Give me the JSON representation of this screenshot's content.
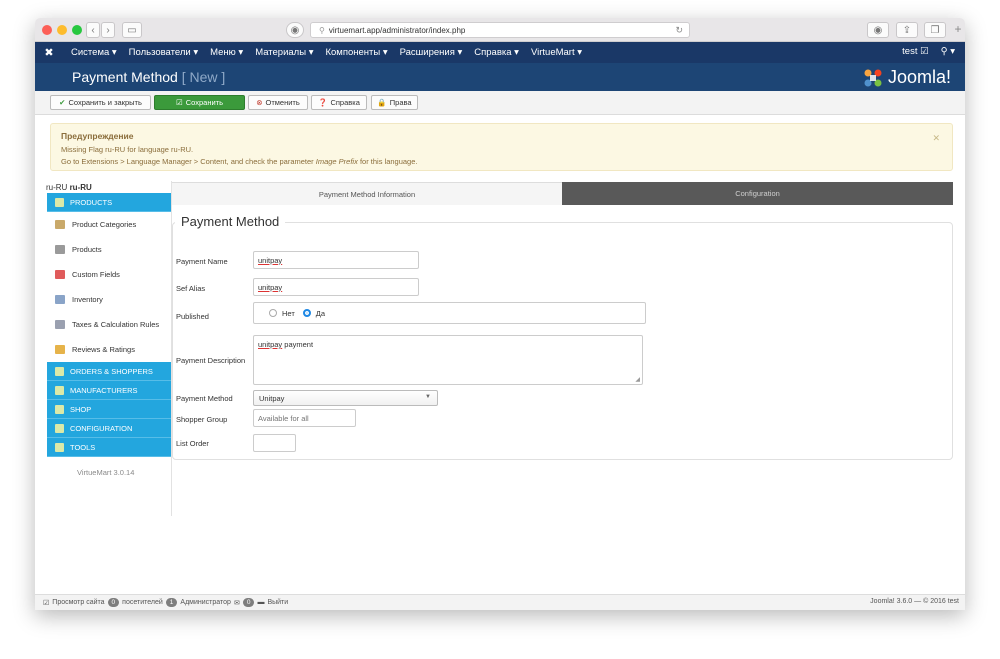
{
  "browser": {
    "url": "virtuemart.app/administrator/index.php"
  },
  "adminbar": {
    "menu": [
      "Система ▾",
      "Пользователи ▾",
      "Меню ▾",
      "Материалы ▾",
      "Компоненты ▾",
      "Расширения ▾",
      "Справка ▾",
      "VirtueMart ▾"
    ],
    "user": "test ☑",
    "user_menu": "⚲ ▾"
  },
  "header": {
    "title": "Payment Method",
    "subtitle": "[ New ]",
    "brand": "Joomla!"
  },
  "toolbar": {
    "save_close": "Сохранить и закрыть",
    "save": "Сохранить",
    "cancel": "Отменить",
    "help": "Справка",
    "rights": "Права"
  },
  "warning": {
    "title": "Предупреждение",
    "line1": "Missing Flag ru-RU for language ru-RU.",
    "line2_prefix": "Go to Extensions > Language Manager > Content, and check the parameter ",
    "line2_em": "Image Prefix",
    "line2_suffix": " for this language."
  },
  "lang": {
    "prefix": "ru-RU ",
    "bold": "ru-RU"
  },
  "sidebar": {
    "products_header": "PRODUCTS",
    "items": [
      {
        "label": "Product Categories",
        "icon_color": "#c9a96a"
      },
      {
        "label": "Products",
        "icon_color": "#9a9a9a"
      },
      {
        "label": "Custom Fields",
        "icon_color": "#e05b5b"
      },
      {
        "label": "Inventory",
        "icon_color": "#8aa4c8"
      },
      {
        "label": "Taxes & Calculation Rules",
        "icon_color": "#9aa0b0"
      },
      {
        "label": "Reviews & Ratings",
        "icon_color": "#e6b34a"
      }
    ],
    "categories": [
      "ORDERS & SHOPPERS",
      "MANUFACTURERS",
      "SHOP",
      "CONFIGURATION",
      "TOOLS"
    ],
    "version": "VirtueMart 3.0.14"
  },
  "tabs": {
    "info": "Payment Method Information",
    "config": "Configuration"
  },
  "form": {
    "legend": "Payment Method",
    "name_label": "Payment Name",
    "name_value": "unitpay",
    "alias_label": "Sef Alias",
    "alias_value": "unitpay",
    "published_label": "Published",
    "published_no": "Нет",
    "published_yes": "Да",
    "description_label": "Payment Description",
    "description_word": "unitpay",
    "description_rest": " payment",
    "method_label": "Payment Method",
    "method_value": "Unitpay",
    "group_label": "Shopper Group",
    "group_placeholder": "Available for all",
    "order_label": "List Order",
    "order_value": ""
  },
  "footer": {
    "view_site": "Просмотр сайта",
    "visitors_count": "0",
    "visitors_label": "посетителей",
    "admins_count": "1",
    "admins_label": "Администратор",
    "messages_count": "0",
    "logout": "Выйти",
    "version": "Joomla! 3.6.0 — © 2016 test"
  },
  "colors": {
    "navbar": "#1a3867",
    "header": "#1d4575",
    "sidebar_accent": "#23a6de",
    "save_green": "#3b9a3b",
    "inactive_tab": "#595959"
  }
}
